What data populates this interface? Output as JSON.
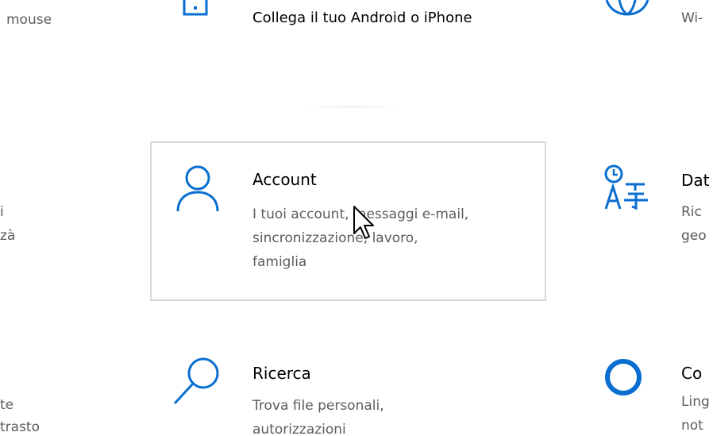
{
  "colors": {
    "accent": "#0a6ed1",
    "text_primary": "#000000",
    "text_secondary": "#5c5c5c",
    "tile_border": "#d9d9d9"
  },
  "left_column": {
    "top_fragment": "mouse",
    "mid_fragment_1": "i",
    "mid_fragment_2": "zà",
    "bottom_fragment_1": "te",
    "bottom_fragment_2": "trasto"
  },
  "tiles": {
    "phone": {
      "icon": "phone-icon",
      "title": "Collega il tuo Android o iPhone"
    },
    "account": {
      "icon": "person-icon",
      "title": "Account",
      "desc_line1": "I tuoi account, messaggi e-mail,",
      "desc_line2": "sincronizzazione, lavoro,",
      "desc_line3": "famiglia"
    },
    "search": {
      "icon": "search-icon",
      "title": "Ricerca",
      "desc_line1": "Trova file personali,",
      "desc_line2": "autorizzazioni"
    }
  },
  "right_column": {
    "network_fragment": "Wi-",
    "time_title_fragment": "Dat",
    "time_desc_1": "Ric",
    "time_desc_2": "geo",
    "cortana_title_fragment": "Co",
    "cortana_desc_1": "Ling",
    "cortana_desc_2": "not"
  },
  "icons": {
    "globe": "globe-icon",
    "time_language": "time-language-icon",
    "cortana": "cortana-icon",
    "cursor": "mouse-cursor-icon"
  }
}
